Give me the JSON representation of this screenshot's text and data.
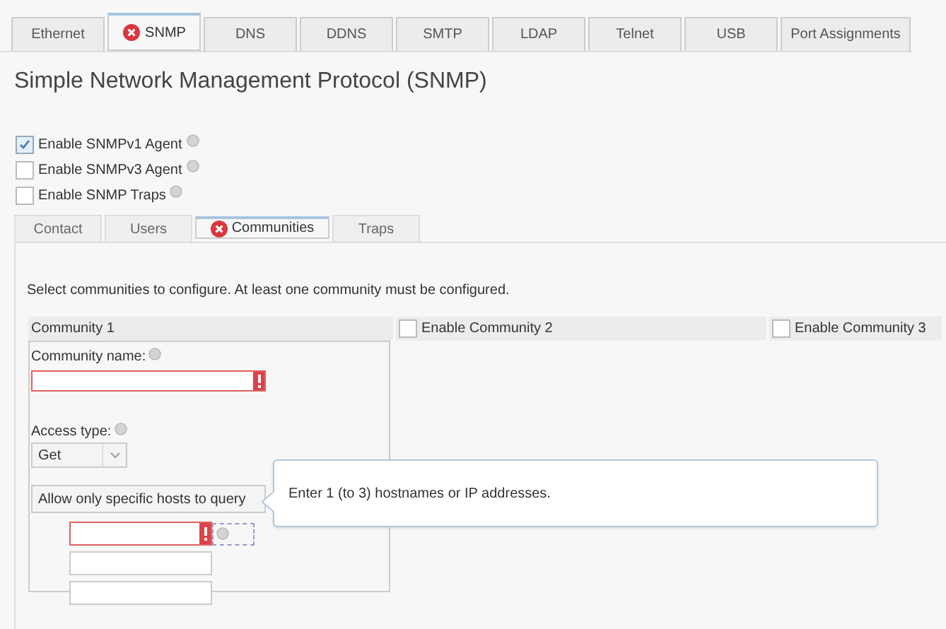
{
  "tabs": [
    {
      "label": "Ethernet",
      "selected": false,
      "error": false
    },
    {
      "label": "SNMP",
      "selected": true,
      "error": true
    },
    {
      "label": "DNS",
      "selected": false,
      "error": false
    },
    {
      "label": "DDNS",
      "selected": false,
      "error": false
    },
    {
      "label": "SMTP",
      "selected": false,
      "error": false
    },
    {
      "label": "LDAP",
      "selected": false,
      "error": false
    },
    {
      "label": "Telnet",
      "selected": false,
      "error": false
    },
    {
      "label": "USB",
      "selected": false,
      "error": false
    },
    {
      "label": "Port Assignments",
      "selected": false,
      "error": false
    }
  ],
  "title": "Simple Network Management Protocol (SNMP)",
  "options": [
    {
      "label": "Enable SNMPv1 Agent",
      "checked": true
    },
    {
      "label": "Enable SNMPv3 Agent",
      "checked": false
    },
    {
      "label": "Enable SNMP Traps",
      "checked": false
    }
  ],
  "subtabs": [
    {
      "label": "Contact",
      "selected": false,
      "error": false
    },
    {
      "label": "Users",
      "selected": false,
      "error": false
    },
    {
      "label": "Communities",
      "selected": true,
      "error": true
    },
    {
      "label": "Traps",
      "selected": false,
      "error": false
    }
  ],
  "instruction": "Select communities to configure. At least one community must be configured.",
  "communities": [
    {
      "label": "Community 1",
      "kind": "fixed"
    },
    {
      "label": "Enable Community 2",
      "kind": "toggle",
      "checked": false
    },
    {
      "label": "Enable Community 3",
      "kind": "toggle",
      "checked": false
    }
  ],
  "community_name": {
    "label": "Community name:",
    "invalid": true
  },
  "access_type": {
    "label": "Access type:",
    "value": "Get"
  },
  "hosts_toggle": {
    "label": "Allow only specific hosts to query"
  },
  "hosts": [
    {
      "invalid": true
    },
    {
      "invalid": false
    },
    {
      "invalid": false
    }
  ],
  "tooltip": "Enter 1 (to 3) hostnames or IP addresses."
}
